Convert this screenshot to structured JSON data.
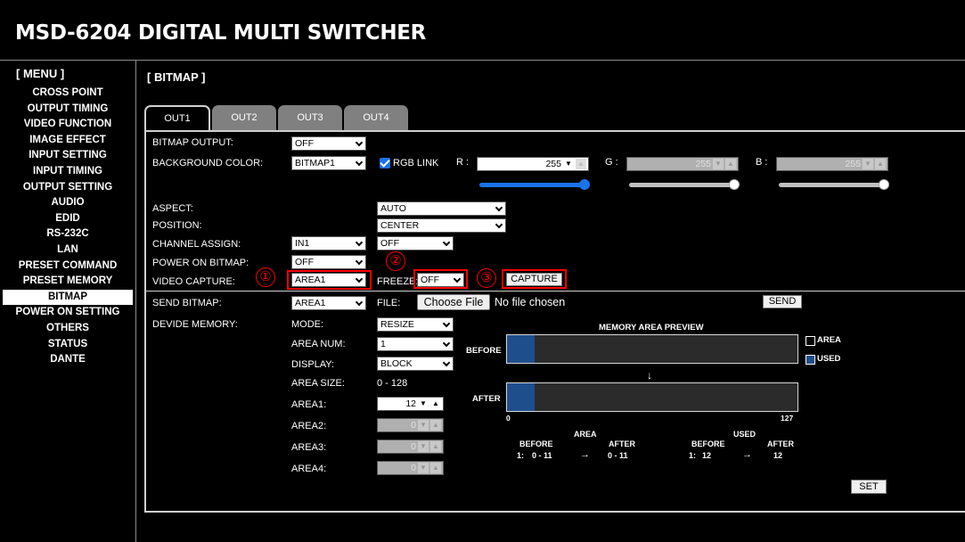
{
  "app": {
    "title": "MSD-6204 DIGITAL MULTI SWITCHER"
  },
  "menu": {
    "header": "[ MENU ]",
    "items": [
      "CROSS POINT",
      "OUTPUT TIMING",
      "VIDEO FUNCTION",
      "IMAGE EFFECT",
      "INPUT SETTING",
      "INPUT TIMING",
      "OUTPUT SETTING",
      "AUDIO",
      "EDID",
      "RS-232C",
      "LAN",
      "PRESET COMMAND",
      "PRESET MEMORY",
      "BITMAP",
      "POWER ON SETTING",
      "OTHERS",
      "STATUS",
      "DANTE"
    ],
    "active": "BITMAP"
  },
  "section": {
    "title": "[ BITMAP ]"
  },
  "tabs": [
    "OUT1",
    "OUT2",
    "OUT3",
    "OUT4"
  ],
  "form": {
    "bitmap_output": {
      "label": "BITMAP OUTPUT:",
      "value": "OFF"
    },
    "background_color": {
      "label": "BACKGROUND COLOR:",
      "value": "BITMAP1",
      "rgb_link": "RGB LINK",
      "r_label": "R :",
      "r_value": "255",
      "g_label": "G :",
      "g_value": "255",
      "b_label": "B :",
      "b_value": "255"
    },
    "aspect": {
      "label": "ASPECT:",
      "value": "AUTO"
    },
    "position": {
      "label": "POSITION:",
      "value": "CENTER"
    },
    "channel_assign": {
      "label": "CHANNEL ASSIGN:",
      "value1": "IN1",
      "value2": "OFF"
    },
    "power_on_bitmap": {
      "label": "POWER ON BITMAP:",
      "value": "OFF"
    },
    "video_capture": {
      "label": "VIDEO CAPTURE:",
      "value": "AREA1",
      "freeze_label": "FREEZE:",
      "freeze_value": "OFF",
      "capture_button": "CAPTURE"
    },
    "send_bitmap": {
      "label": "SEND BITMAP:",
      "value": "AREA1",
      "file_label": "FILE:",
      "choose_file": "Choose File",
      "no_file": "No file chosen",
      "send_button": "SEND"
    },
    "divide_memory": {
      "label": "DEVIDE MEMORY:",
      "mode_label": "MODE:",
      "mode_value": "RESIZE",
      "area_num_label": "AREA NUM:",
      "area_num_value": "1",
      "display_label": "DISPLAY:",
      "display_value": "BLOCK",
      "area_size_label": "AREA SIZE:",
      "area_size_value": "0 - 128",
      "area1_label": "AREA1:",
      "area1_value": "12",
      "area2_label": "AREA2:",
      "area2_value": "0",
      "area3_label": "AREA3:",
      "area3_value": "0",
      "area4_label": "AREA4:",
      "area4_value": "0",
      "set_button": "SET"
    }
  },
  "annotations": {
    "one": "①",
    "two": "②",
    "three": "③"
  },
  "preview": {
    "title": "MEMORY AREA PREVIEW",
    "before": "BEFORE",
    "after": "AFTER",
    "legend_area": "AREA",
    "legend_used": "USED",
    "arrow_down": "↓",
    "scale_min": "0",
    "scale_max": "127",
    "used_fraction_before": 0.094,
    "used_fraction_after": 0.094,
    "table": {
      "area_header": "AREA",
      "used_header": "USED",
      "before": "BEFORE",
      "after": "AFTER",
      "row_index": "1:",
      "area_before": "0 - 11",
      "area_after": "0 - 11",
      "used_index": "1:",
      "used_before": "12",
      "used_after": "12",
      "arrow": "→"
    }
  },
  "colors": {
    "background": "#000000",
    "fill_used": "#1f4e8c",
    "slider_blue": "#1a73e8",
    "annotation_red": "#ff0000"
  }
}
